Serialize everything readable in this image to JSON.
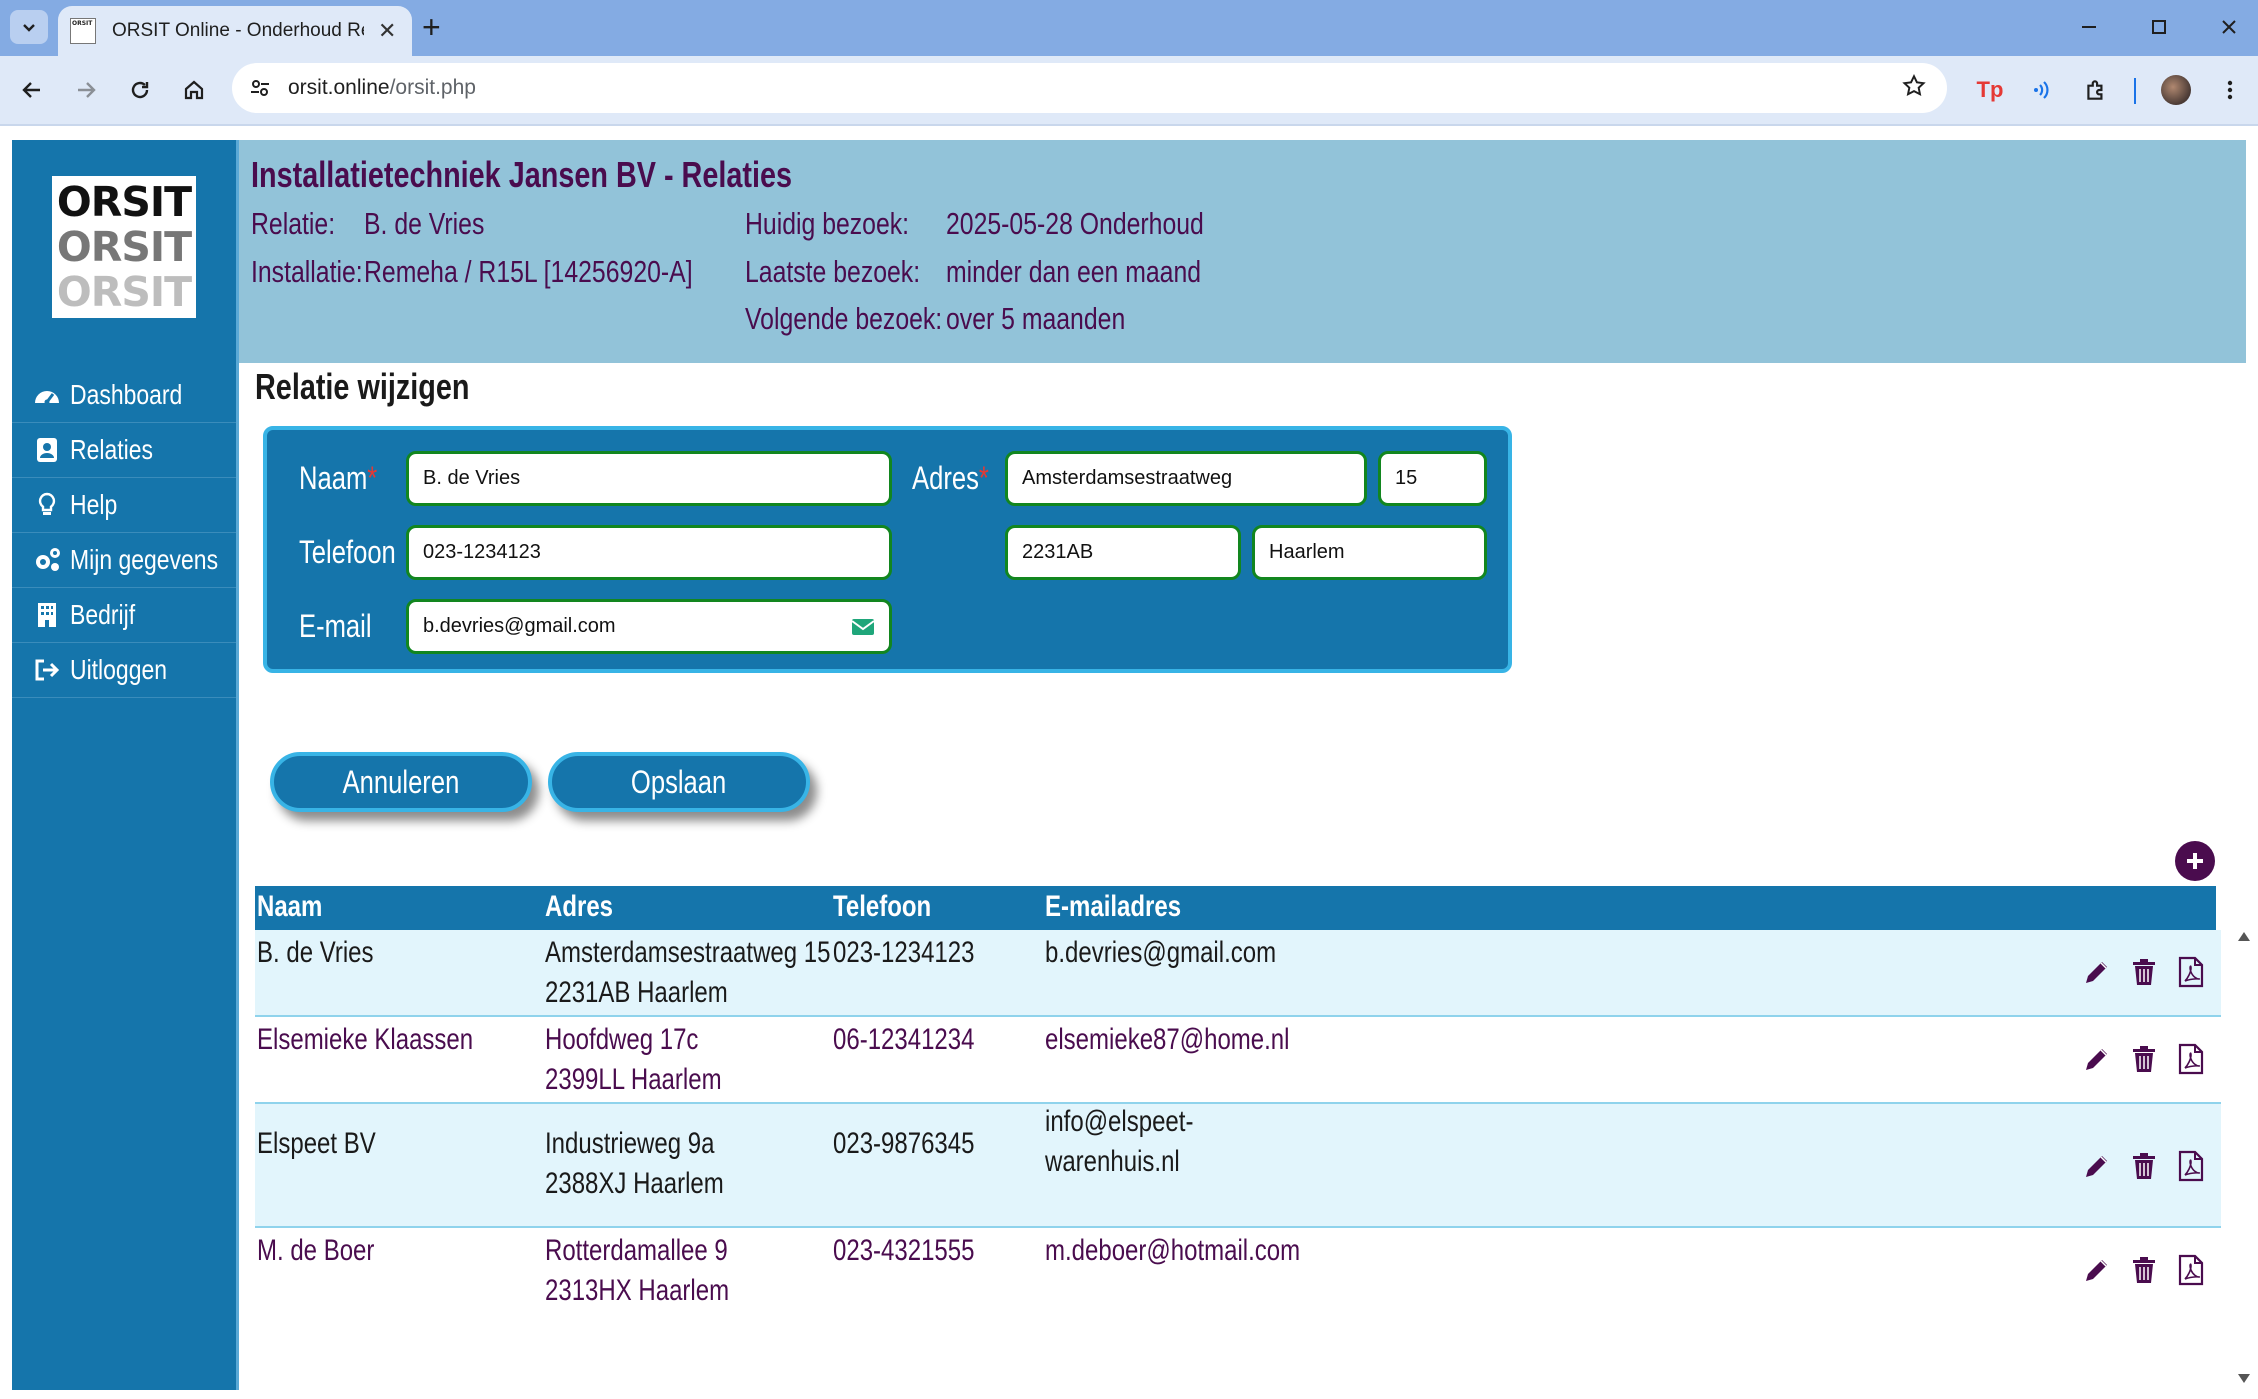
{
  "browser": {
    "tab_title": "ORSIT Online - Onderhoud Reg",
    "favicon_text": "ORSIT",
    "url_host": "orsit.online",
    "url_path": "/orsit.php",
    "extension_badge": "Tp"
  },
  "sidebar": {
    "logo_lines": [
      "ORSIT",
      "ORSIT",
      "ORSIT"
    ],
    "items": [
      {
        "label": "Dashboard",
        "icon": "dashboard-icon"
      },
      {
        "label": "Relaties",
        "icon": "contact-card-icon"
      },
      {
        "label": "Help",
        "icon": "lightbulb-icon"
      },
      {
        "label": "Mijn gegevens",
        "icon": "gears-icon"
      },
      {
        "label": "Bedrijf",
        "icon": "building-icon"
      },
      {
        "label": "Uitloggen",
        "icon": "logout-icon"
      }
    ]
  },
  "header": {
    "title": "Installatietechniek Jansen BV - Relaties",
    "relatie_label": "Relatie:",
    "relatie_value": "B. de Vries",
    "installatie_label": "Installatie:",
    "installatie_value": "Remeha / R15L [14256920-A]",
    "huidig_label": "Huidig bezoek:",
    "huidig_value": "2025-05-28 Onderhoud",
    "laatste_label": "Laatste bezoek:",
    "laatste_value": "minder dan een maand",
    "volgende_label": "Volgende bezoek:",
    "volgende_value": "over 5 maanden"
  },
  "form": {
    "section_title": "Relatie wijzigen",
    "naam_label": "Naam",
    "adres_label": "Adres",
    "telefoon_label": "Telefoon",
    "email_label": "E-mail",
    "required_mark": "*",
    "naam_value": "B. de Vries",
    "straat_value": "Amsterdamsestraatweg",
    "huisnummer_value": "15",
    "telefoon_value": "023-1234123",
    "postcode_value": "2231AB",
    "plaats_value": "Haarlem",
    "email_value": "b.devries@gmail.com",
    "cancel_label": "Annuleren",
    "save_label": "Opslaan"
  },
  "table": {
    "headers": [
      "Naam",
      "Adres",
      "Telefoon",
      "E-mailadres"
    ],
    "rows": [
      {
        "naam": "B. de Vries",
        "adres1": "Amsterdamsestraatweg 15",
        "adres2": "2231AB Haarlem",
        "telefoon": "023-1234123",
        "email1": "b.devries@gmail.com",
        "email2": ""
      },
      {
        "naam": "Elsemieke Klaassen",
        "adres1": "Hoofdweg 17c",
        "adres2": "2399LL Haarlem",
        "telefoon": "06-12341234",
        "email1": "elsemieke87@home.nl",
        "email2": ""
      },
      {
        "naam": "Elspeet BV",
        "adres1": "Industrieweg 9a",
        "adres2": "2388XJ Haarlem",
        "telefoon": "023-9876345",
        "email1": "info@elspeet-",
        "email2": "warenhuis.nl"
      },
      {
        "naam": "M. de Boer",
        "adres1": "Rotterdamallee 9",
        "adres2": "2313HX Haarlem",
        "telefoon": "023-4321555",
        "email1": "m.deboer@hotmail.com",
        "email2": ""
      }
    ]
  },
  "colors": {
    "sidebar": "#1575ab",
    "header_bg": "#92c3d9",
    "accent_text": "#4a0c4e",
    "input_border": "#12861f",
    "panel_border": "#38b4e6"
  }
}
